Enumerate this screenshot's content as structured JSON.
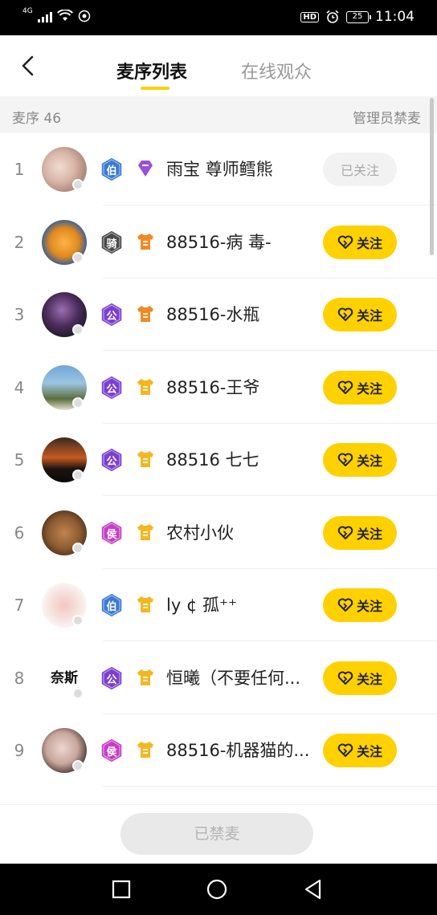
{
  "status_bar": {
    "network": "4G",
    "hd": "HD",
    "battery": "25",
    "time": "11:04"
  },
  "header": {
    "tabs": [
      {
        "label": "麦序列表"
      },
      {
        "label": "在线观众"
      }
    ]
  },
  "subbar": {
    "queue_label": "麦序 46",
    "admin_action": "管理员禁麦"
  },
  "colors": {
    "accent": "#FFD100",
    "level_blue": "#3A7BD5",
    "level_purple": "#7B3FD4",
    "level_magenta": "#C63CC6",
    "level_dark": "#4A4A4A"
  },
  "rows": [
    {
      "num": "1",
      "level": "伯",
      "level_color": "#3A7BD5",
      "badge_icon": "purple-badge-icon",
      "name": "雨宝 尊师鳕熊",
      "button": "已关注",
      "followed": true
    },
    {
      "num": "2",
      "level": "骑",
      "level_color": "#4A4A4A",
      "badge_icon": "orange-shirt-icon",
      "name": "88516-病 毒-",
      "button": "关注",
      "followed": false
    },
    {
      "num": "3",
      "level": "公",
      "level_color": "#7B3FD4",
      "badge_icon": "orange-shirt-icon",
      "name": "88516-水瓶",
      "button": "关注",
      "followed": false
    },
    {
      "num": "4",
      "level": "公",
      "level_color": "#7B3FD4",
      "badge_icon": "yellow-shirt-icon",
      "name": "88516-王爷",
      "button": "关注",
      "followed": false
    },
    {
      "num": "5",
      "level": "公",
      "level_color": "#7B3FD4",
      "badge_icon": "yellow-shirt-icon",
      "name": "88516  七七",
      "button": "关注",
      "followed": false
    },
    {
      "num": "6",
      "level": "侯",
      "level_color": "#C63CC6",
      "badge_icon": "yellow-shirt-icon",
      "name": "农村小伙",
      "button": "关注",
      "followed": false
    },
    {
      "num": "7",
      "level": "伯",
      "level_color": "#3A7BD5",
      "badge_icon": "yellow-shirt-icon",
      "name": "ly ¢ 孤⁺⁺",
      "button": "关注",
      "followed": false
    },
    {
      "num": "8",
      "level": "公",
      "level_color": "#7B3FD4",
      "badge_icon": "yellow-shirt-icon",
      "name": "恒曦（不要任何...",
      "button": "关注",
      "followed": false,
      "avatar_text": "奈斯"
    },
    {
      "num": "9",
      "level": "侯",
      "level_color": "#C63CC6",
      "badge_icon": "yellow-shirt-icon",
      "name": "88516-机器猫的...",
      "button": "关注",
      "followed": false
    }
  ],
  "bottom": {
    "ban_button": "已禁麦"
  }
}
